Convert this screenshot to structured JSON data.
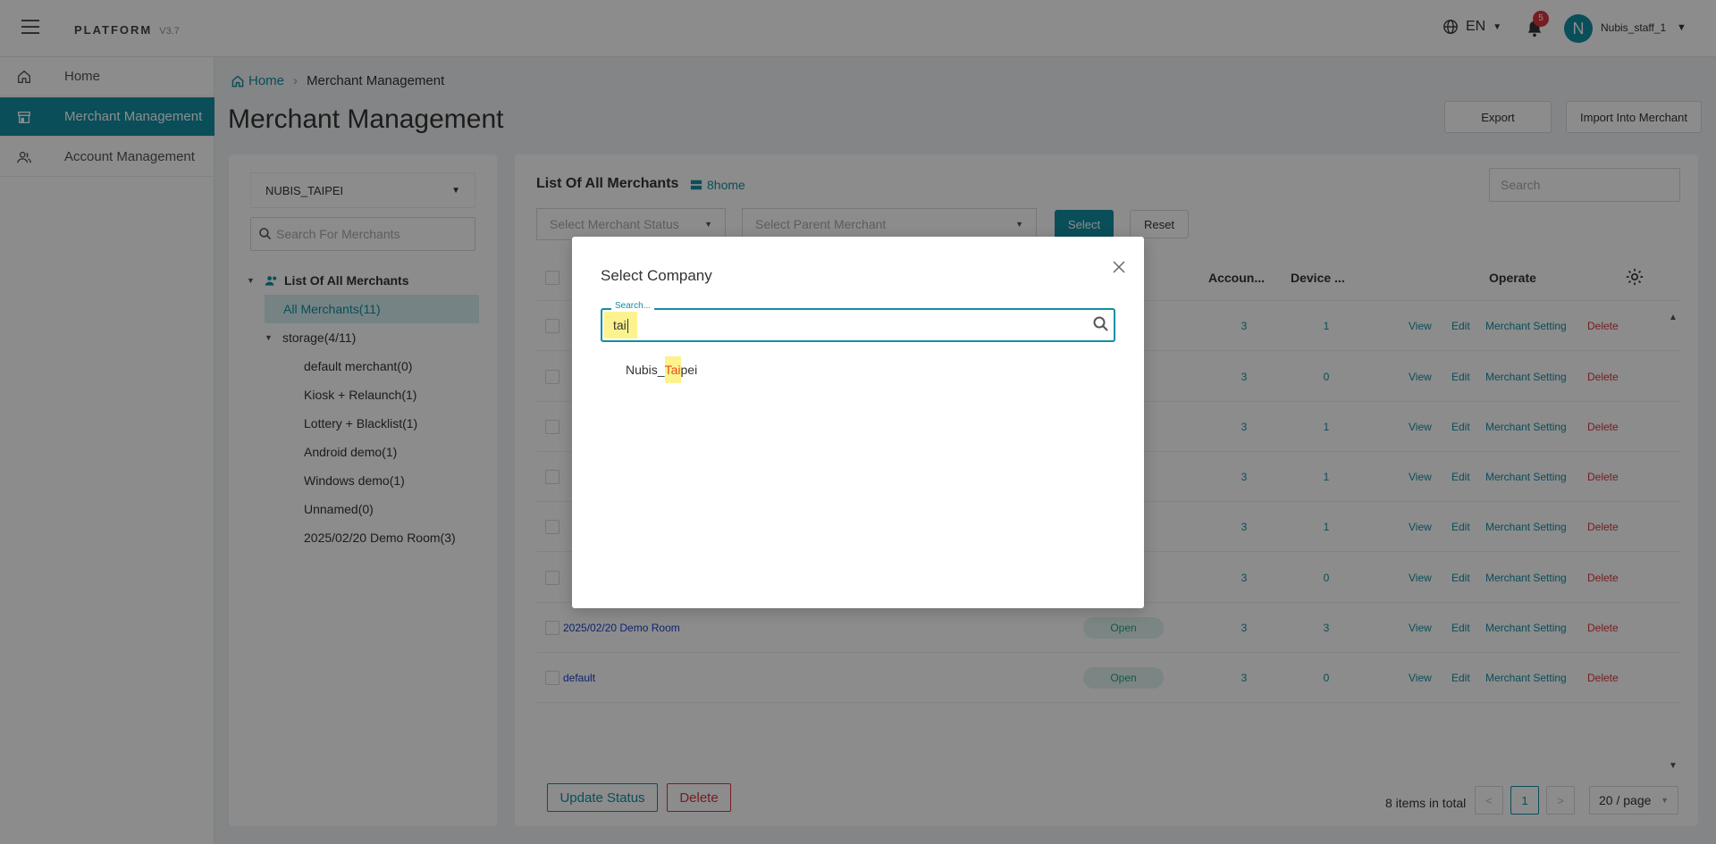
{
  "header": {
    "brand": "PLATFORM",
    "version": "V3.7",
    "language": "EN",
    "notification_count": "5",
    "avatar_letter": "N",
    "username": "Nubis_staff_1"
  },
  "sidebar": {
    "items": [
      {
        "label": "Home",
        "icon": "home-icon"
      },
      {
        "label": "Merchant Management",
        "icon": "store-icon"
      },
      {
        "label": "Account Management",
        "icon": "users-icon"
      }
    ]
  },
  "breadcrumb": {
    "home": "Home",
    "current": "Merchant Management"
  },
  "page_title": "Merchant Management",
  "actions": {
    "export": "Export",
    "import": "Import Into Merchant"
  },
  "left_panel": {
    "company_select": "NUBIS_TAIPEI",
    "search_placeholder": "Search For Merchants",
    "tree_root": "List Of All Merchants",
    "tree_all": "All Merchants(11)",
    "tree_group": "storage(4/11)",
    "tree_children": [
      "default merchant(0)",
      "Kiosk + Relaunch(1)",
      "Lottery + Blacklist(1)",
      "Android demo(1)",
      "Windows demo(1)",
      "Unnamed(0)",
      "2025/02/20 Demo Room(3)"
    ]
  },
  "main": {
    "list_title": "List Of All Merchants",
    "list_tag": "8home",
    "search_placeholder": "Search",
    "filter_status": "Select Merchant Status",
    "filter_parent": "Select Parent Merchant",
    "select_btn": "Select",
    "reset_btn": "Reset",
    "columns": {
      "accounts": "Accoun...",
      "devices": "Device ...",
      "operate": "Operate"
    },
    "rows": [
      {
        "name": "",
        "status": "",
        "accounts": "3",
        "devices": "1"
      },
      {
        "name": "",
        "status": "",
        "accounts": "3",
        "devices": "0"
      },
      {
        "name": "",
        "status": "",
        "accounts": "3",
        "devices": "1"
      },
      {
        "name": "",
        "status": "",
        "accounts": "3",
        "devices": "1"
      },
      {
        "name": "",
        "status": "",
        "accounts": "3",
        "devices": "1"
      },
      {
        "name": "",
        "status": "",
        "accounts": "3",
        "devices": "0"
      },
      {
        "name": "2025/02/20 Demo Room",
        "status": "Open",
        "accounts": "3",
        "devices": "3"
      },
      {
        "name": "default",
        "status": "Open",
        "accounts": "3",
        "devices": "0"
      }
    ],
    "row_actions": {
      "view": "View",
      "edit": "Edit",
      "setting": "Merchant Setting",
      "delete": "Delete"
    },
    "update_status_btn": "Update Status",
    "delete_btn": "Delete",
    "total": "8 items in total",
    "page_prev": "<",
    "page_current": "1",
    "page_next": ">",
    "per_page": "20 / page"
  },
  "modal": {
    "title": "Select Company",
    "field_label": "Search...",
    "field_value": "tai",
    "result_prefix": "Nubis_",
    "result_match": "Tai",
    "result_suffix": "pei"
  },
  "colors": {
    "accent": "#118ea3",
    "danger": "#d9363e",
    "highlight": "#fcf38e",
    "open_status": "#29a27a"
  }
}
